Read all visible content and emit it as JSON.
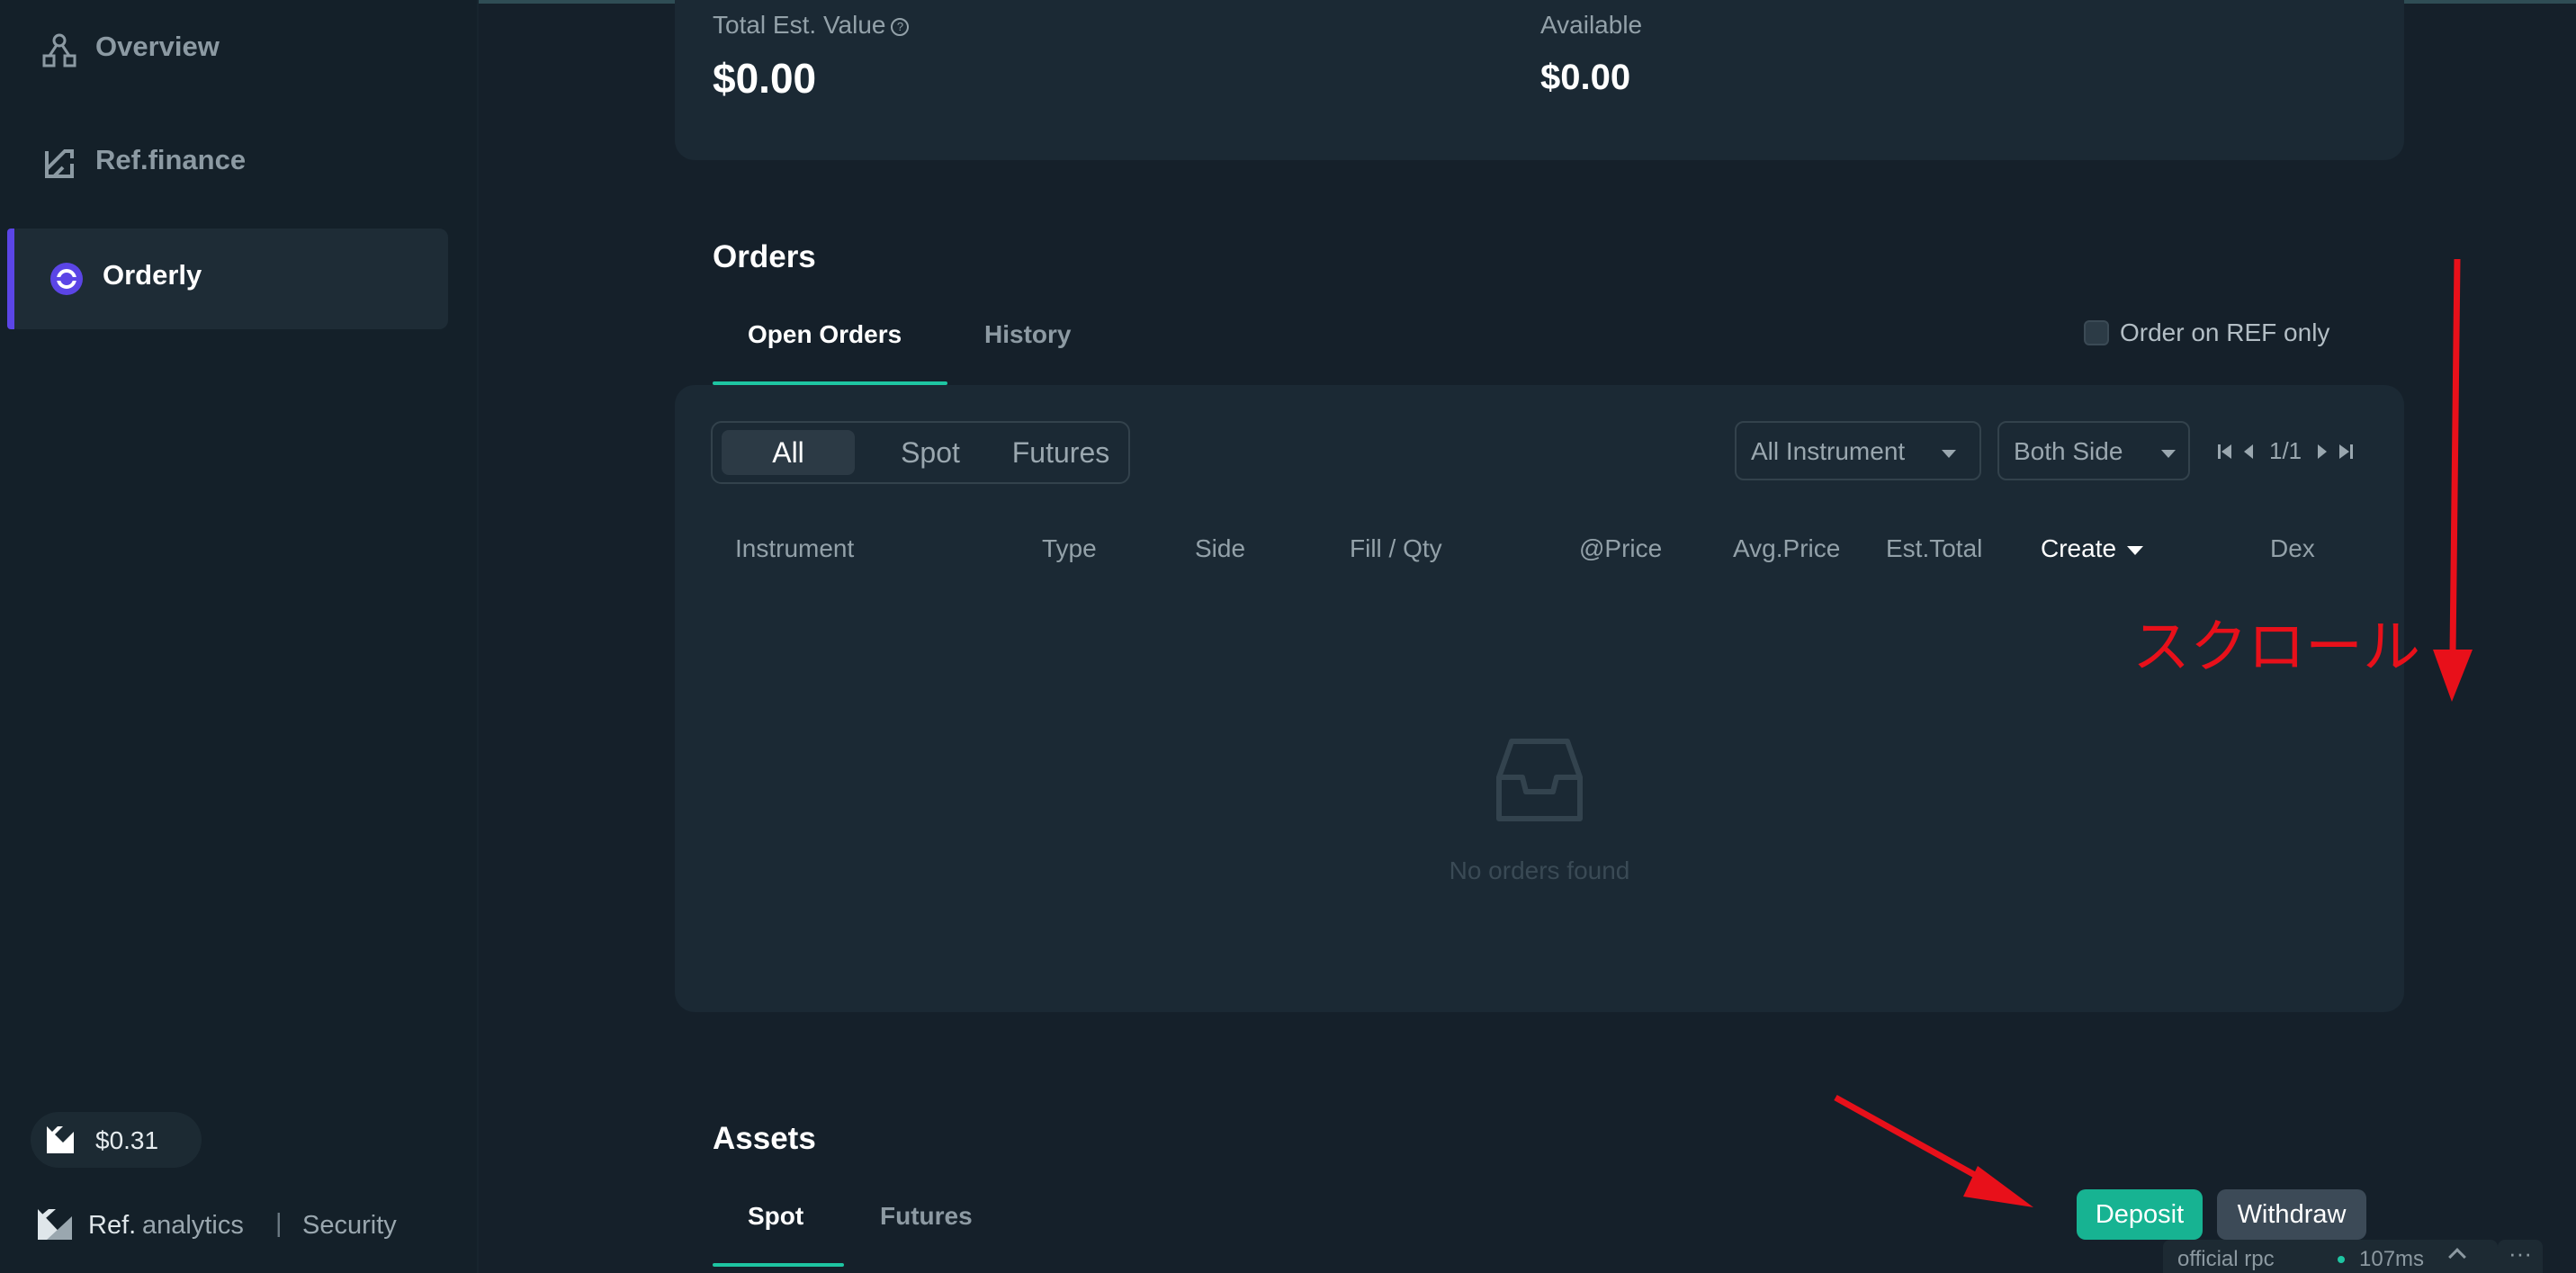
{
  "sidebar": {
    "items": [
      {
        "label": "Overview",
        "icon": "overview-icon"
      },
      {
        "label": "Ref.finance",
        "icon": "ref-finance-icon"
      },
      {
        "label": "Orderly",
        "icon": "orderly-icon",
        "active": true
      }
    ],
    "price": "$0.31",
    "footer": {
      "ref": "Ref.",
      "analytics": "analytics",
      "separator": "|",
      "security": "Security"
    }
  },
  "balance": {
    "total_label": "Total Est. Value",
    "total_value": "$0.00",
    "available_label": "Available",
    "available_value": "$0.00"
  },
  "orders": {
    "title": "Orders",
    "tabs": [
      {
        "label": "Open Orders",
        "active": true
      },
      {
        "label": "History"
      }
    ],
    "ref_only_label": "Order on REF only",
    "filter_segments": [
      {
        "label": "All",
        "active": true
      },
      {
        "label": "Spot"
      },
      {
        "label": "Futures"
      }
    ],
    "instrument_dropdown": "All Instrument",
    "side_dropdown": "Both Side",
    "pagination": "1/1",
    "columns": [
      "Instrument",
      "Type",
      "Side",
      "Fill / Qty",
      "@Price",
      "Avg.Price",
      "Est.Total",
      "Create",
      "Dex"
    ],
    "empty_text": "No orders found"
  },
  "annotation": {
    "scroll_text": "スクロール",
    "color": "#e8101a"
  },
  "assets": {
    "title": "Assets",
    "tabs": [
      {
        "label": "Spot",
        "active": true
      },
      {
        "label": "Futures"
      }
    ],
    "deposit_label": "Deposit",
    "withdraw_label": "Withdraw"
  },
  "status_bar": {
    "rpc": "official rpc",
    "latency": "107ms",
    "more": "···"
  },
  "colors": {
    "accent": "#1ec5a2",
    "active_bar": "#5b45e6",
    "deposit": "#17b392"
  }
}
